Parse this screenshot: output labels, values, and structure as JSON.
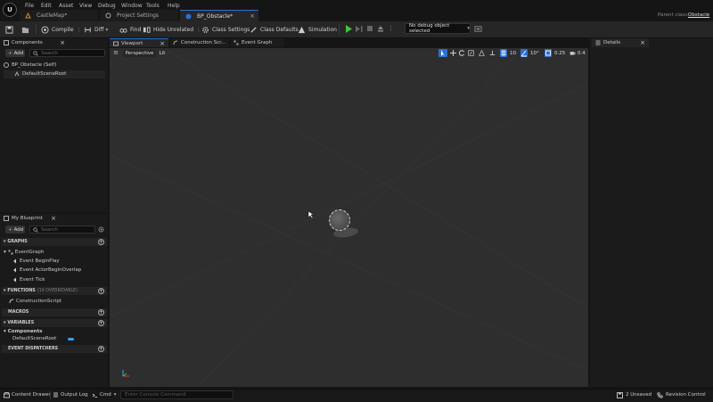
{
  "menu": [
    "File",
    "Edit",
    "Asset",
    "View",
    "Debug",
    "Window",
    "Tools",
    "Help"
  ],
  "tabs": [
    {
      "label": "CastleMap*"
    },
    {
      "label": "Project Settings"
    },
    {
      "label": "BP_Obstacle*"
    }
  ],
  "parent_class": {
    "label": "Parent class:",
    "value": "Obstacle"
  },
  "toolbar": {
    "compile": "Compile",
    "diff": "Diff",
    "find": "Find",
    "hide_unrelated": "Hide Unrelated",
    "class_settings": "Class Settings",
    "class_defaults": "Class Defaults",
    "simulation": "Simulation",
    "debug_select": "No debug object selected"
  },
  "components_panel": {
    "title": "Components",
    "add": "Add",
    "search_placeholder": "Search",
    "root": "BP_Obstacle (Self)",
    "child": "DefaultSceneRoot"
  },
  "editor_tabs": {
    "viewport": "Viewport",
    "construction": "Construction Scr...",
    "event_graph": "Event Graph"
  },
  "viewport": {
    "perspective": "Perspective",
    "lit": "Lit",
    "grid_snap": "10",
    "rot_snap": "10°",
    "scale_snap": "0.25",
    "cam_speed": "0.4"
  },
  "details": {
    "title": "Details"
  },
  "my_blueprint": {
    "title": "My Blueprint",
    "add": "Add",
    "search_placeholder": "Search",
    "graphs_label": "GRAPHS",
    "event_graph": "EventGraph",
    "events": [
      "Event BeginPlay",
      "Event ActorBeginOverlap",
      "Event Tick"
    ],
    "functions_label": "FUNCTIONS",
    "functions_note": "(19 OVERRIDABLE)",
    "construction_script": "ConstructionScript",
    "macros_label": "MACROS",
    "variables_label": "VARIABLES",
    "components_category": "Components",
    "component_var": "DefaultSceneRoot",
    "dispatchers_label": "EVENT DISPATCHERS"
  },
  "bottom": {
    "content_drawer": "Content Drawer",
    "output_log": "Output Log",
    "cmd": "Cmd",
    "console_placeholder": "Enter Console Command",
    "unsaved": "2 Unsaved",
    "revision": "Revision Control"
  },
  "colors": {
    "accent": "#2f6fd0",
    "play": "#3ec33e",
    "active_tab_line": "#2f6fd0"
  }
}
